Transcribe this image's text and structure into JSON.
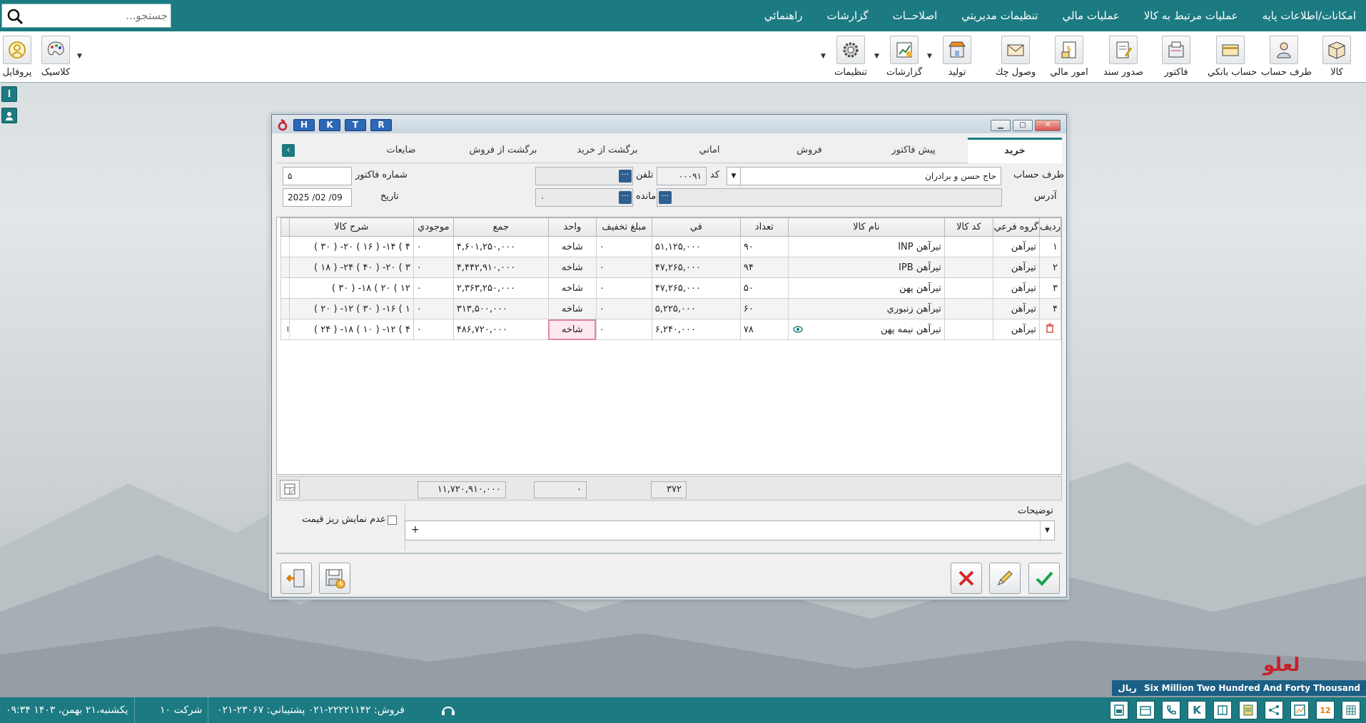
{
  "menu": {
    "items": [
      "امکانات/اطلاعات پايه",
      "عمليات مرتبط به کالا",
      "عمليات مالي",
      "تنظيمات مديريتي",
      "اصلاحــات",
      "گزارشات",
      "راهنمائي"
    ],
    "search_placeholder": "جستجو..."
  },
  "toolbar": {
    "items": [
      "کالا",
      "طرف حساب",
      "حساب بانکي",
      "فاکتور",
      "صدور سند",
      "امور مالي",
      "وصول چك",
      "توليد",
      "گزارشات",
      "تنظيمات"
    ],
    "left": [
      "کلاسيک",
      "پروفايل"
    ]
  },
  "dialog": {
    "hk_buttons": [
      "H",
      "K",
      "T",
      "R"
    ],
    "tabs": [
      "خريد",
      "پيش فاکتور",
      "فروش",
      "اماني",
      "برگشت از خريد",
      "برگشت از فروش",
      "ضايعات"
    ],
    "header": {
      "party_label": "طرف حساب",
      "party_value": "حاج حسن و برادران",
      "code_label": "کد",
      "code_value": "۰۰۰۹۱",
      "phone_label": "تلفن",
      "phone_value": "",
      "invoice_no_label": "شماره فاکتور",
      "invoice_no_value": "۵",
      "address_label": "آدرس",
      "address_value": "",
      "balance_label": "مانده",
      "balance_value": "۰",
      "date_label": "تاريخ",
      "date_value": "2025 /02 /09"
    },
    "columns": [
      "رديف",
      "گروه فرعي",
      "کد کالا",
      "نام کالا",
      "تعداد",
      "في",
      "مبلغ تخفيف",
      "واحد",
      "جمع",
      "موجودي",
      "شرح کالا"
    ],
    "rows": [
      {
        "no": "۱",
        "group": "تيرآهن",
        "code": "",
        "name": "تيرآهن INP",
        "qty": "۹۰",
        "price": "۵۱,۱۲۵,۰۰۰",
        "discount": "۰",
        "unit": "شاخه",
        "total": "۴,۶۰۱,۲۵۰,۰۰۰",
        "stock": "۰",
        "desc": "۴ ) ۱۴- ( ۱۶ ) ۲۰- ( ۳۰ )"
      },
      {
        "no": "۲",
        "group": "تيرآهن",
        "code": "",
        "name": "تيرآهن IPB",
        "qty": "۹۴",
        "price": "۴۷,۲۶۵,۰۰۰",
        "discount": "۰",
        "unit": "شاخه",
        "total": "۴,۴۴۲,۹۱۰,۰۰۰",
        "stock": "۰",
        "desc": "۳ ) ۲۰- ( ۴۰ ) ۲۴- ( ۱۸ )"
      },
      {
        "no": "۳",
        "group": "تيرآهن",
        "code": "",
        "name": "تيرآهن پهن",
        "qty": "۵۰",
        "price": "۴۷,۲۶۵,۰۰۰",
        "discount": "۰",
        "unit": "شاخه",
        "total": "۲,۳۶۳,۲۵۰,۰۰۰",
        "stock": "۰",
        "desc": "۱۲ ) ۲۰ ) ۱۸- ( ۳۰ )"
      },
      {
        "no": "۴",
        "group": "تيرآهن",
        "code": "",
        "name": "تيرآهن زنبوري",
        "qty": "۶۰",
        "price": "۵,۲۲۵,۰۰۰",
        "discount": "۰",
        "unit": "شاخه",
        "total": "۳۱۳,۵۰۰,۰۰۰",
        "stock": "۰",
        "desc": "۱ ) ۱۶- ( ۳۰ ) ۱۲- ( ۲۰ )"
      },
      {
        "no": "",
        "group": "تيرآهن",
        "code": "",
        "name": "تيرآهن نيمه پهن",
        "qty": "۷۸",
        "price": "۶,۲۴۰,۰۰۰",
        "discount": "۰",
        "unit": "شاخه",
        "total": "۴۸۶,۷۲۰,۰۰۰",
        "stock": "۰",
        "desc": "۴ ) ۱۲- ( ۱۰ ) ۱۸- ( ۲۴ )"
      }
    ],
    "totals": {
      "qty": "۳۷۲",
      "discount": "۰",
      "sum": "۱۱,۷۲۰,۹۱۰,۰۰۰"
    },
    "notes_label": "توضيحات",
    "notes_value": "+",
    "hide_price_detail_label": "عدم نمايش ريز قيمت",
    "hide_price_detail_checked": false
  },
  "brand": {
    "logo_text": "لعلو"
  },
  "amount_caption": {
    "words": "Six Million Two Hundred  And Forty Thousand",
    "currency": "ريال"
  },
  "status": {
    "datetime": "يکشنبه،۲۱ بهمن، ۱۴۰۳  ۰۹:۳۴",
    "company": "شرکت ۱۰",
    "contacts": "فروش:  ۲۲۲۲۱۱۴۲-۰۲۱  پشتيباني: ۲۳۰۶۷-۰۲۱",
    "calendar_day": "12"
  },
  "colors": {
    "primary": "#1c7a82",
    "accent_blue": "#2d67b5",
    "confirm": "#1aa34a",
    "cancel": "#d62828",
    "logo_red": "#c8202b"
  }
}
